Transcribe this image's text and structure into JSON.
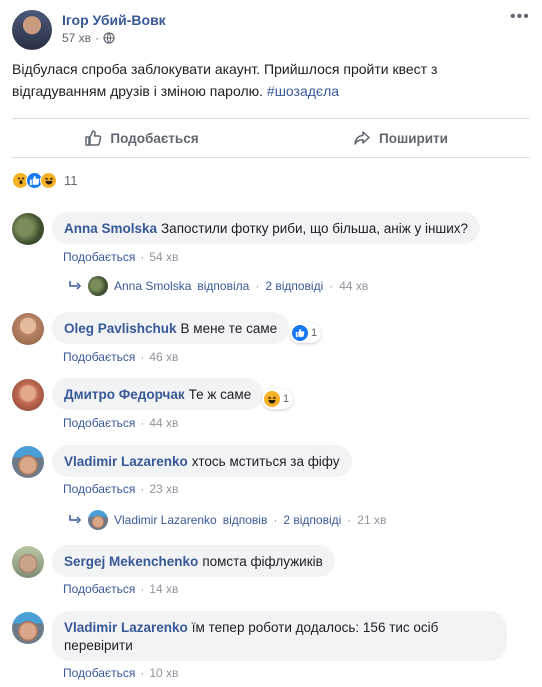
{
  "post": {
    "author": "Ігор Убий-Вовк",
    "time": "57 хв",
    "text": "Відбулася спроба заблокувати акаунт. Прийшлося пройти квест з відгадуванням друзів і зміною паролю.",
    "hashtag": "#шозадєла",
    "like_label": "Подобається",
    "share_label": "Поширити",
    "reactions_count": "11"
  },
  "like_label": "Подобається",
  "comments": [
    {
      "author": "Anna Smolska",
      "text": "Запостили фотку риби, що більша, аніж у інших?",
      "time": "54 хв",
      "reply": {
        "author": "Anna Smolska",
        "verb": "відповіла",
        "count": "2 відповіді",
        "time": "44 хв"
      }
    },
    {
      "author": "Oleg Pavlishchuk",
      "text": "В мене те саме",
      "time": "46 хв",
      "reaction_count": "1"
    },
    {
      "author": "Дмитро Федорчак",
      "text": "Те ж саме",
      "time": "44 хв",
      "reaction_count": "1"
    },
    {
      "author": "Vladimir Lazarenko",
      "text": "хтось мститься за фіфу",
      "time": "23 хв",
      "reply": {
        "author": "Vladimir Lazarenko",
        "verb": "відповів",
        "count": "2 відповіді",
        "time": "21 хв"
      }
    },
    {
      "author": "Sergej Mekenchenko",
      "text": "помста фіфлужиків",
      "time": "14 хв"
    },
    {
      "author": "Vladimir Lazarenko",
      "text": "їм тепер роботи додалось: 156 тис осіб перевірити",
      "time": "10 хв"
    }
  ],
  "colors": {
    "link": "#385898",
    "muted": "#90949c",
    "bubble": "#f2f3f5",
    "like_blue": "#1877f2",
    "haha_yellow": "#f7b125"
  }
}
